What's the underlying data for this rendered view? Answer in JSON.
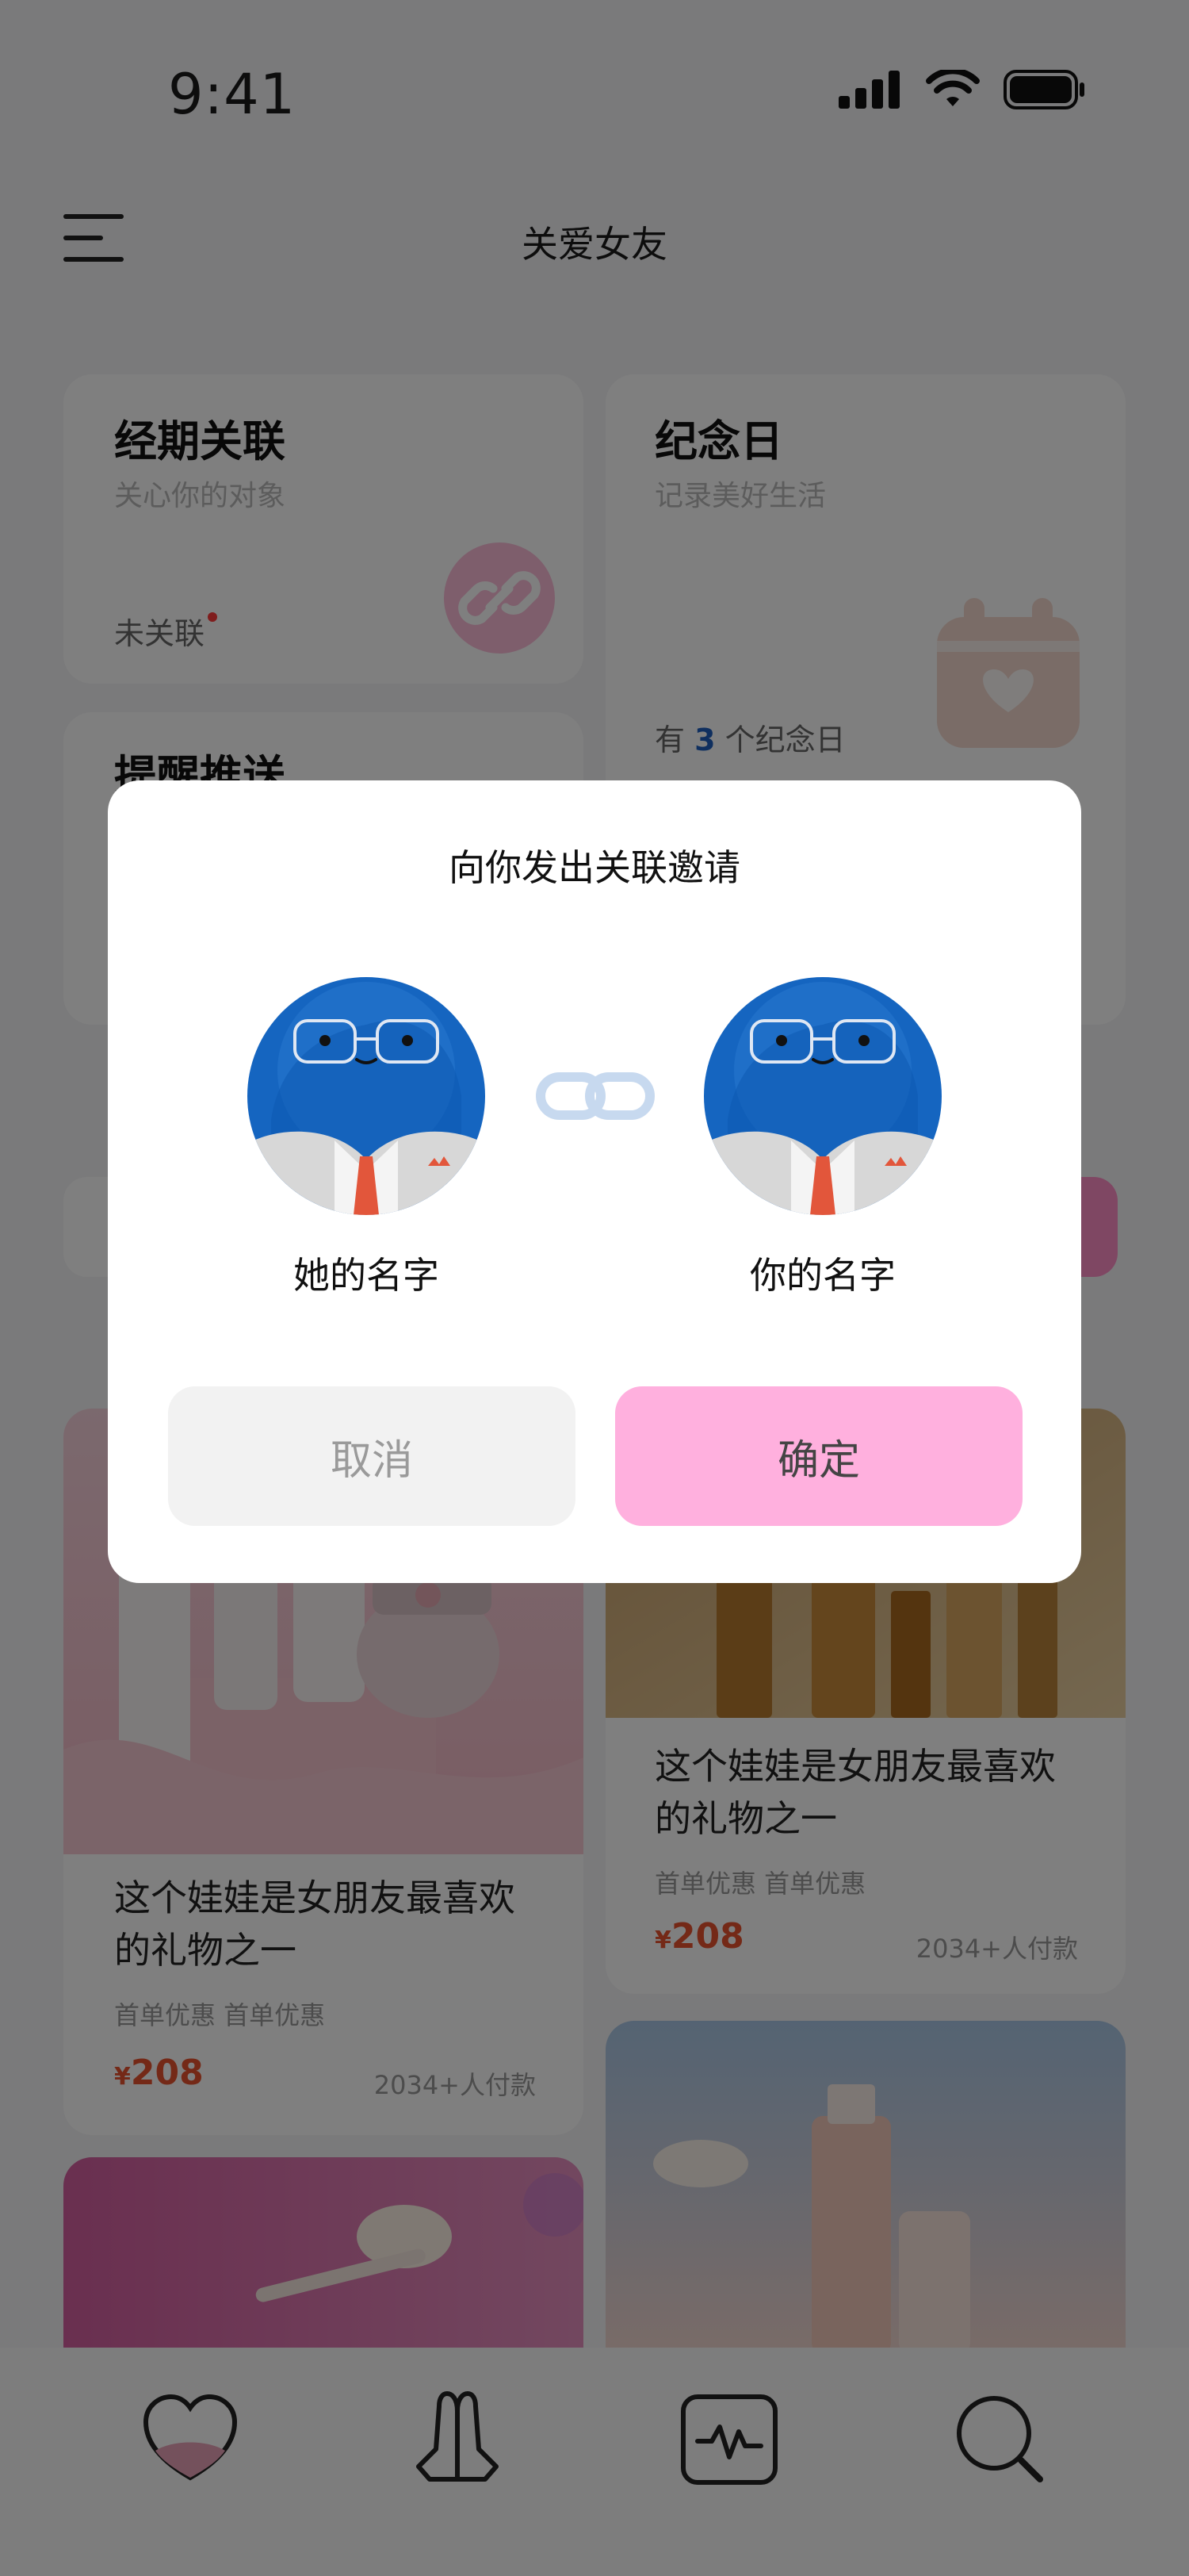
{
  "status_bar": {
    "time": "9:41"
  },
  "header": {
    "title": "关爱女友"
  },
  "cards": {
    "period": {
      "title": "经期关联",
      "subtitle": "关心你的对象",
      "status": "未关联"
    },
    "anniversary": {
      "title": "纪念日",
      "subtitle": "记录美好生活",
      "count_prefix": "有",
      "count": "3",
      "count_suffix": "个纪念日"
    },
    "reminder": {
      "title": "提醒推送"
    }
  },
  "products": [
    {
      "title": "这个娃娃是女朋友最喜欢的礼物之一",
      "tags": "首单优惠  首单优惠",
      "currency": "¥",
      "price": "208",
      "sold": "2034+人付款"
    },
    {
      "title": "这个娃娃是女朋友最喜欢的礼物之一",
      "tags": "首单优惠  首单优惠",
      "currency": "¥",
      "price": "208",
      "sold": "2034+人付款"
    }
  ],
  "modal": {
    "title": "向你发出关联邀请",
    "left_name": "她的名字",
    "right_name": "你的名字",
    "cancel_label": "取消",
    "confirm_label": "确定"
  },
  "nav": {
    "icons": [
      "heart-icon",
      "pray-hands-icon",
      "pulse-icon",
      "search-icon"
    ]
  },
  "colors": {
    "accent_pink": "#ffb0de",
    "price_red": "#e8532e",
    "avatar_blue": "#1565c0",
    "highlight_blue": "#1f5fbf"
  }
}
